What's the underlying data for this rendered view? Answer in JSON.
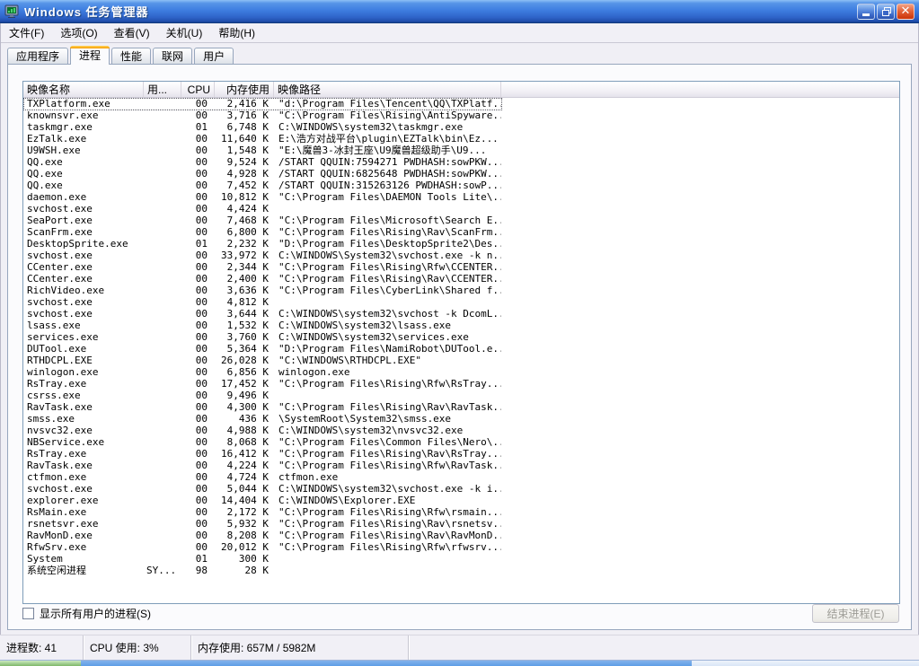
{
  "window": {
    "title": "Windows 任务管理器"
  },
  "colors": {
    "titlebar_blue": "#2e63c8",
    "active_tab_orange": "#f59a00",
    "close_button_red": "#cf3c10",
    "taskbar_blue": "#5e9de6",
    "start_button_green": "#7db869"
  },
  "menu": {
    "items": [
      "文件(F)",
      "选项(O)",
      "查看(V)",
      "关机(U)",
      "帮助(H)"
    ]
  },
  "tabs": [
    {
      "label": "应用程序",
      "active": false
    },
    {
      "label": "进程",
      "active": true
    },
    {
      "label": "性能",
      "active": false
    },
    {
      "label": "联网",
      "active": false
    },
    {
      "label": "用户",
      "active": false
    }
  ],
  "process_table": {
    "columns": [
      "映像名称",
      "用...",
      "CPU",
      "内存使用",
      "映像路径"
    ],
    "rows": [
      {
        "name": "TXPlatform.exe",
        "user": "",
        "cpu": "00",
        "mem": "2,416 K",
        "path": "\"d:\\Program Files\\Tencent\\QQ\\TXPlatf...",
        "focused": true
      },
      {
        "name": "knownsvr.exe",
        "user": "",
        "cpu": "00",
        "mem": "3,716 K",
        "path": "\"C:\\Program Files\\Rising\\AntiSpyware..."
      },
      {
        "name": "taskmgr.exe",
        "user": "",
        "cpu": "01",
        "mem": "6,748 K",
        "path": "C:\\WINDOWS\\system32\\taskmgr.exe"
      },
      {
        "name": "EzTalk.exe",
        "user": "",
        "cpu": "00",
        "mem": "11,640 K",
        "path": "E:\\浩方对战平台\\plugin\\EZTalk\\bin\\Ez..."
      },
      {
        "name": "U9WSH.exe",
        "user": "",
        "cpu": "00",
        "mem": "1,548 K",
        "path": "\"E:\\魔兽3-冰封王座\\U9魔兽超级助手\\U9..."
      },
      {
        "name": "QQ.exe",
        "user": "",
        "cpu": "00",
        "mem": "9,524 K",
        "path": "/START QQUIN:7594271 PWDHASH:sowPKW..."
      },
      {
        "name": "QQ.exe",
        "user": "",
        "cpu": "00",
        "mem": "4,928 K",
        "path": "/START QQUIN:6825648 PWDHASH:sowPKW..."
      },
      {
        "name": "QQ.exe",
        "user": "",
        "cpu": "00",
        "mem": "7,452 K",
        "path": "/START QQUIN:315263126 PWDHASH:sowP..."
      },
      {
        "name": "daemon.exe",
        "user": "",
        "cpu": "00",
        "mem": "10,812 K",
        "path": "\"C:\\Program Files\\DAEMON Tools Lite\\..."
      },
      {
        "name": "svchost.exe",
        "user": "",
        "cpu": "00",
        "mem": "4,424 K",
        "path": ""
      },
      {
        "name": "SeaPort.exe",
        "user": "",
        "cpu": "00",
        "mem": "7,468 K",
        "path": "\"C:\\Program Files\\Microsoft\\Search E..."
      },
      {
        "name": "ScanFrm.exe",
        "user": "",
        "cpu": "00",
        "mem": "6,800 K",
        "path": "\"C:\\Program Files\\Rising\\Rav\\ScanFrm..."
      },
      {
        "name": "DesktopSprite.exe",
        "user": "",
        "cpu": "01",
        "mem": "2,232 K",
        "path": "\"D:\\Program Files\\DesktopSprite2\\Des..."
      },
      {
        "name": "svchost.exe",
        "user": "",
        "cpu": "00",
        "mem": "33,972 K",
        "path": "C:\\WINDOWS\\System32\\svchost.exe -k n..."
      },
      {
        "name": "CCenter.exe",
        "user": "",
        "cpu": "00",
        "mem": "2,344 K",
        "path": "\"C:\\Program Files\\Rising\\Rfw\\CCENTER..."
      },
      {
        "name": "CCenter.exe",
        "user": "",
        "cpu": "00",
        "mem": "2,400 K",
        "path": "\"C:\\Program Files\\Rising\\Rav\\CCENTER..."
      },
      {
        "name": "RichVideo.exe",
        "user": "",
        "cpu": "00",
        "mem": "3,636 K",
        "path": "\"C:\\Program Files\\CyberLink\\Shared f..."
      },
      {
        "name": "svchost.exe",
        "user": "",
        "cpu": "00",
        "mem": "4,812 K",
        "path": ""
      },
      {
        "name": "svchost.exe",
        "user": "",
        "cpu": "00",
        "mem": "3,644 K",
        "path": "C:\\WINDOWS\\system32\\svchost -k DcomL..."
      },
      {
        "name": "lsass.exe",
        "user": "",
        "cpu": "00",
        "mem": "1,532 K",
        "path": "C:\\WINDOWS\\system32\\lsass.exe"
      },
      {
        "name": "services.exe",
        "user": "",
        "cpu": "00",
        "mem": "3,760 K",
        "path": "C:\\WINDOWS\\system32\\services.exe"
      },
      {
        "name": "DUTool.exe",
        "user": "",
        "cpu": "00",
        "mem": "5,364 K",
        "path": "\"D:\\Program Files\\NamiRobot\\DUTool.e..."
      },
      {
        "name": "RTHDCPL.EXE",
        "user": "",
        "cpu": "00",
        "mem": "26,028 K",
        "path": "\"C:\\WINDOWS\\RTHDCPL.EXE\""
      },
      {
        "name": "winlogon.exe",
        "user": "",
        "cpu": "00",
        "mem": "6,856 K",
        "path": "winlogon.exe"
      },
      {
        "name": "RsTray.exe",
        "user": "",
        "cpu": "00",
        "mem": "17,452 K",
        "path": "\"C:\\Program Files\\Rising\\Rfw\\RsTray...."
      },
      {
        "name": "csrss.exe",
        "user": "",
        "cpu": "00",
        "mem": "9,496 K",
        "path": ""
      },
      {
        "name": "RavTask.exe",
        "user": "",
        "cpu": "00",
        "mem": "4,300 K",
        "path": "\"C:\\Program Files\\Rising\\Rav\\RavTask..."
      },
      {
        "name": "smss.exe",
        "user": "",
        "cpu": "00",
        "mem": "436 K",
        "path": "\\SystemRoot\\System32\\smss.exe"
      },
      {
        "name": "nvsvc32.exe",
        "user": "",
        "cpu": "00",
        "mem": "4,988 K",
        "path": "C:\\WINDOWS\\system32\\nvsvc32.exe"
      },
      {
        "name": "NBService.exe",
        "user": "",
        "cpu": "00",
        "mem": "8,068 K",
        "path": "\"C:\\Program Files\\Common Files\\Nero\\..."
      },
      {
        "name": "RsTray.exe",
        "user": "",
        "cpu": "00",
        "mem": "16,412 K",
        "path": "\"C:\\Program Files\\Rising\\Rav\\RsTray...."
      },
      {
        "name": "RavTask.exe",
        "user": "",
        "cpu": "00",
        "mem": "4,224 K",
        "path": "\"C:\\Program Files\\Rising\\Rfw\\RavTask..."
      },
      {
        "name": "ctfmon.exe",
        "user": "",
        "cpu": "00",
        "mem": "4,724 K",
        "path": "ctfmon.exe"
      },
      {
        "name": "svchost.exe",
        "user": "",
        "cpu": "00",
        "mem": "5,044 K",
        "path": "C:\\WINDOWS\\system32\\svchost.exe -k i..."
      },
      {
        "name": "explorer.exe",
        "user": "",
        "cpu": "00",
        "mem": "14,404 K",
        "path": "C:\\WINDOWS\\Explorer.EXE"
      },
      {
        "name": "RsMain.exe",
        "user": "",
        "cpu": "00",
        "mem": "2,172 K",
        "path": "\"C:\\Program Files\\Rising\\Rfw\\rsmain...."
      },
      {
        "name": "rsnetsvr.exe",
        "user": "",
        "cpu": "00",
        "mem": "5,932 K",
        "path": "\"C:\\Program Files\\Rising\\Rav\\rsnetsv..."
      },
      {
        "name": "RavMonD.exe",
        "user": "",
        "cpu": "00",
        "mem": "8,208 K",
        "path": "\"C:\\Program Files\\Rising\\Rav\\RavMonD..."
      },
      {
        "name": "RfwSrv.exe",
        "user": "",
        "cpu": "00",
        "mem": "20,012 K",
        "path": "\"C:\\Program Files\\Rising\\Rfw\\rfwsrv...."
      },
      {
        "name": "System",
        "user": "",
        "cpu": "01",
        "mem": "300 K",
        "path": ""
      },
      {
        "name": "系统空闲进程",
        "user": "SY...",
        "cpu": "98",
        "mem": "28 K",
        "path": ""
      }
    ]
  },
  "footer": {
    "show_all_users_label": "显示所有用户的进程(S)",
    "show_all_users_checked": false,
    "end_process_label": "结束进程(E)",
    "end_process_enabled": false
  },
  "status": {
    "processes": "进程数: 41",
    "cpu": "CPU 使用: 3%",
    "memory": "内存使用: 657M / 5982M"
  }
}
